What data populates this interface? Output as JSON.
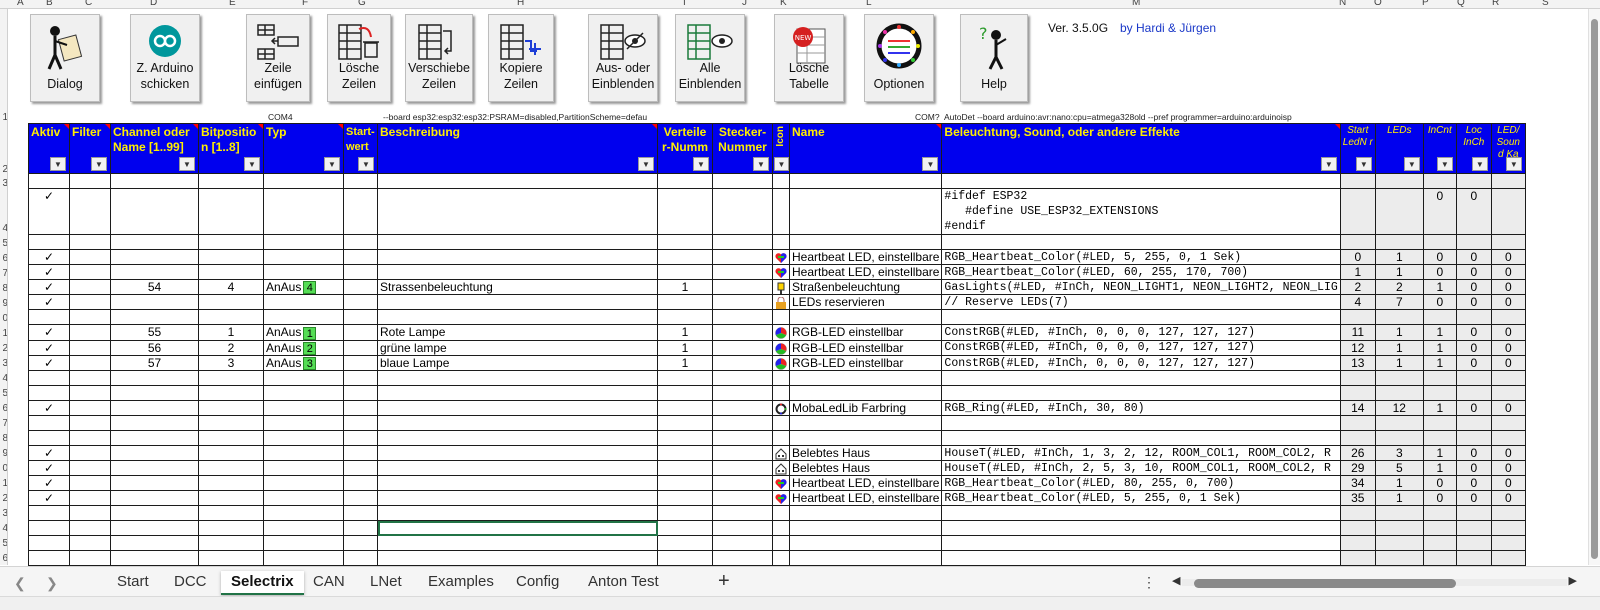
{
  "column_letters": [
    "A",
    "B",
    "C",
    "D",
    "E",
    "F",
    "G",
    "H",
    "I",
    "J",
    "K",
    "L",
    "M",
    "N",
    "O",
    "P",
    "Q",
    "R",
    "S"
  ],
  "row_numbers": [
    "1",
    "2",
    "3",
    "4",
    "5",
    "6",
    "7",
    "8",
    "9",
    "0",
    "1",
    "2",
    "3",
    "4",
    "5",
    "6",
    "7",
    "8",
    "9",
    "0",
    "1",
    "2",
    "3",
    "4",
    "5",
    "6"
  ],
  "toolbar": {
    "dialog": "Dialog",
    "send_arduino": "Z. Arduino\nschicken",
    "insert_row": "Zeile\neinfügen",
    "delete_rows": "Lösche\nZeilen",
    "move_rows": "Verschiebe\nZeilen",
    "copy_rows": "Kopiere\nZeilen",
    "hide_show": "Aus- oder\nEinblenden",
    "show_all": "Alle\nEinblenden",
    "delete_table": "Lösche\nTabelle",
    "options": "Optionen",
    "help": "Help"
  },
  "version": "Ver. 3.5.0G",
  "authors": "by  Hardi & Jürgen",
  "info": {
    "com4": "COM4",
    "board_esp": "--board esp32:esp32:esp32:PSRAM=disabled,PartitionScheme=defau",
    "com_q": "COM?",
    "board_nano": "AutoDet --board arduino:avr:nano:cpu=atmega328old --pref programmer=arduino:arduinoisp"
  },
  "headers": {
    "aktiv": "Aktiv",
    "filter": "Filter",
    "channel": "Channel oder Name [1..99]",
    "bitpos": "Bitpositio n [1..8]",
    "typ": "Typ",
    "startwert": "Start-wert",
    "beschreibung": "Beschreibung",
    "verteiler": "Verteile r-Numm",
    "stecker": "Stecker-Nummer",
    "icon": "Icon",
    "name": "Name",
    "effekte": "Beleuchtung, Sound, oder andere Effekte",
    "startled": "Start LedN r",
    "leds": "LEDs",
    "incnt": "InCnt",
    "locinch": "Loc InCh",
    "ledsound": "LED/ Soun d Ka"
  },
  "rows": [
    {
      "aktiv": "✓",
      "code": [
        "#ifdef ESP32",
        "   #define USE_ESP32_EXTENSIONS",
        "#endif"
      ],
      "incnt": "0",
      "locinch": "0"
    },
    {
      "aktiv": "✓",
      "icon": "heart",
      "name": "Heartbeat LED, einstellbare",
      "effekt": "RGB_Heartbeat_Color(#LED, 5, 255, 0, 1 Sek)",
      "start": "0",
      "leds": "1",
      "incnt": "0",
      "loc": "0",
      "ka": "0"
    },
    {
      "aktiv": "✓",
      "icon": "heart",
      "name": "Heartbeat LED, einstellbare",
      "effekt": "RGB_Heartbeat_Color(#LED, 60, 255, 170, 700)",
      "start": "1",
      "leds": "1",
      "incnt": "0",
      "loc": "0",
      "ka": "0"
    },
    {
      "aktiv": "✓",
      "channel": "54",
      "bit": "4",
      "typ": "AnAus",
      "typnum": "4",
      "beschreibung": "Strassenbeleuchtung",
      "verteiler": "1",
      "icon": "lamp",
      "name": "Straßenbeleuchtung",
      "effekt": "GasLights(#LED, #InCh, NEON_LIGHT1, NEON_LIGHT2, NEON_LIG",
      "start": "2",
      "leds": "2",
      "incnt": "1",
      "loc": "0",
      "ka": "0"
    },
    {
      "aktiv": "✓",
      "icon": "lock",
      "name": "LEDs reservieren",
      "effekt": "// Reserve LEDs(7)",
      "start": "4",
      "leds": "7",
      "incnt": "0",
      "loc": "0",
      "ka": "0"
    },
    {
      "aktiv": "✓",
      "channel": "55",
      "bit": "1",
      "typ": "AnAus",
      "typnum": "1",
      "beschreibung": "Rote Lampe",
      "verteiler": "1",
      "icon": "rgb",
      "name": "RGB-LED einstellbar",
      "effekt": "ConstRGB(#LED, #InCh, 0, 0, 0, 127, 127, 127)",
      "start": "11",
      "leds": "1",
      "incnt": "1",
      "loc": "0",
      "ka": "0"
    },
    {
      "aktiv": "✓",
      "channel": "56",
      "bit": "2",
      "typ": "AnAus",
      "typnum": "2",
      "beschreibung": "grüne lampe",
      "verteiler": "1",
      "icon": "rgb",
      "name": "RGB-LED einstellbar",
      "effekt": "ConstRGB(#LED, #InCh, 0, 0, 0, 127, 127, 127)",
      "start": "12",
      "leds": "1",
      "incnt": "1",
      "loc": "0",
      "ka": "0"
    },
    {
      "aktiv": "✓",
      "channel": "57",
      "bit": "3",
      "typ": "AnAus",
      "typnum": "3",
      "beschreibung": "blaue Lampe",
      "verteiler": "1",
      "icon": "rgb",
      "name": "RGB-LED einstellbar",
      "effekt": "ConstRGB(#LED, #InCh, 0, 0, 0, 127, 127, 127)",
      "start": "13",
      "leds": "1",
      "incnt": "1",
      "loc": "0",
      "ka": "0"
    },
    {
      "aktiv": "✓",
      "icon": "ring",
      "name": "MobaLedLib Farbring",
      "effekt": "RGB_Ring(#LED, #InCh, 30, 80)",
      "start": "14",
      "leds": "12",
      "incnt": "1",
      "loc": "0",
      "ka": "0"
    },
    {
      "aktiv": "✓",
      "icon": "house",
      "name": "Belebtes Haus",
      "effekt": "HouseT(#LED, #InCh, 1, 3, 2, 12, ROOM_COL1, ROOM_COL2, R",
      "start": "26",
      "leds": "3",
      "incnt": "1",
      "loc": "0",
      "ka": "0"
    },
    {
      "aktiv": "✓",
      "icon": "house",
      "name": "Belebtes Haus",
      "effekt": "HouseT(#LED, #InCh, 2, 5, 3, 10, ROOM_COL1, ROOM_COL2, R",
      "start": "29",
      "leds": "5",
      "incnt": "1",
      "loc": "0",
      "ka": "0"
    },
    {
      "aktiv": "✓",
      "icon": "heart",
      "name": "Heartbeat LED, einstellbare",
      "effekt": "RGB_Heartbeat_Color(#LED, 80, 255, 0, 700)",
      "start": "34",
      "leds": "1",
      "incnt": "0",
      "loc": "0",
      "ka": "0"
    },
    {
      "aktiv": "✓",
      "icon": "heart",
      "name": "Heartbeat LED, einstellbare",
      "effekt": "RGB_Heartbeat_Color(#LED, 5, 255, 0, 1 Sek)",
      "start": "35",
      "leds": "1",
      "incnt": "0",
      "loc": "0",
      "ka": "0"
    }
  ],
  "tabs": [
    "Start",
    "DCC",
    "Selectrix",
    "CAN",
    "LNet",
    "Examples",
    "Config",
    "Anton Test"
  ],
  "active_tab": "Selectrix",
  "colors": {
    "header_bg": "#0000ee",
    "header_text": "#ffee00",
    "excel_green": "#217346",
    "typ_box": "#55dd55"
  }
}
